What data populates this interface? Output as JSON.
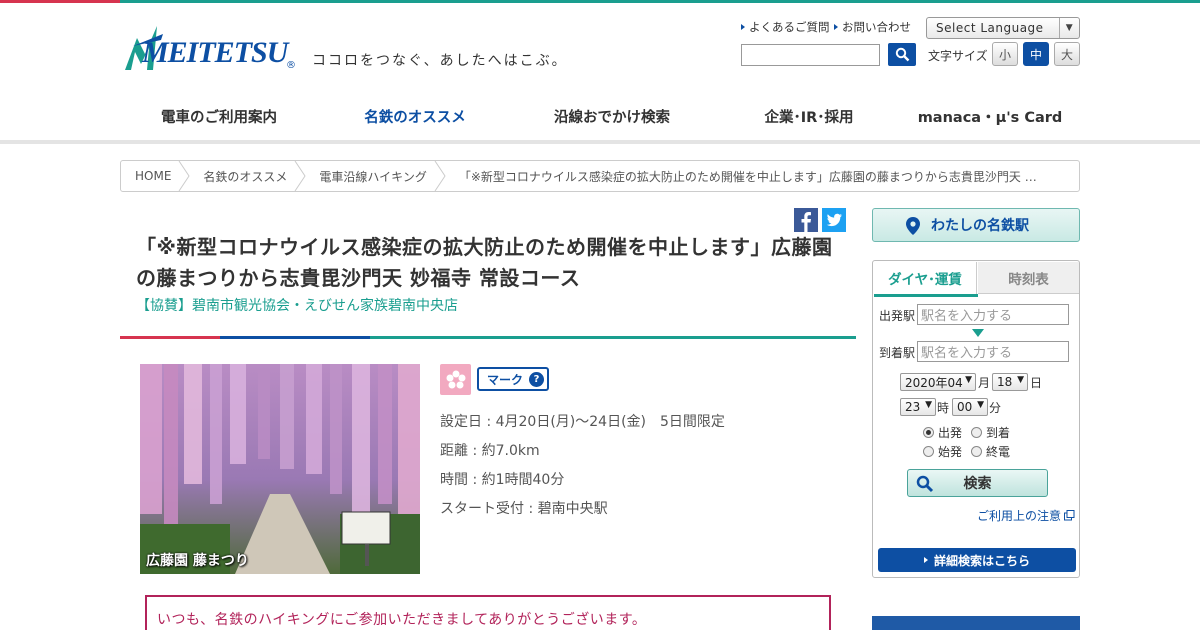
{
  "header": {
    "logo_text": "MEITETSU",
    "logo_reg": "®",
    "slogan": "ココロをつなぐ、あしたへはこぶ。",
    "util_links": [
      "よくあるご質問",
      "お問い合わせ"
    ],
    "language_select": "Select Language",
    "search_placeholder": "",
    "font_size_label": "文字サイズ",
    "font_sizes": [
      "小",
      "中",
      "大"
    ]
  },
  "gnav": [
    "電車のご利用案内",
    "名鉄のオススメ",
    "沿線おでかけ検索",
    "企業･IR･採用",
    "manaca・μ's Card"
  ],
  "breadcrumb": [
    "HOME",
    "名鉄のオススメ",
    "電車沿線ハイキング",
    "「※新型コロナウイルス感染症の拡大防止のため開催を中止します」広藤園の藤まつりから志貴毘沙門天 …"
  ],
  "article": {
    "title": "「※新型コロナウイルス感染症の拡大防止のため開催を中止します」広藤園の藤まつりから志貴毘沙門天 妙福寺 常設コース",
    "sponsor": "【協賛】碧南市観光協会・えびせん家族碧南中央店",
    "photo_caption": "広藤園 藤まつり",
    "mark_label": "マーク",
    "info": [
      "設定日 : 4月20日(月)～24日(金)　5日間限定",
      "距離 : 約7.0km",
      "時間 : 約1時間40分",
      "スタート受付 : 碧南中央駅"
    ],
    "notice": "いつも、名鉄のハイキングにご参加いただきましてありがとうございます。"
  },
  "sidebar": {
    "my_station": "わたしの名鉄駅",
    "tabs": [
      "ダイヤ･運賃",
      "時刻表"
    ],
    "from_label": "出発駅",
    "to_label": "到着駅",
    "station_placeholder": "駅名を入力する",
    "year_month": "2020年04",
    "month_unit": "月",
    "day": "18",
    "day_unit": "日",
    "hour": "23",
    "hour_unit": "時",
    "minute": "00",
    "minute_unit": "分",
    "radios": [
      "出発",
      "到着",
      "始発",
      "終電"
    ],
    "search_button": "検索",
    "caution_link": "ご利用上の注意",
    "detail_button": "詳細検索はこちら"
  },
  "colors": {
    "brand_blue": "#0d4fa3",
    "accent_teal": "#1a9e8f",
    "accent_red": "#d6344f"
  }
}
